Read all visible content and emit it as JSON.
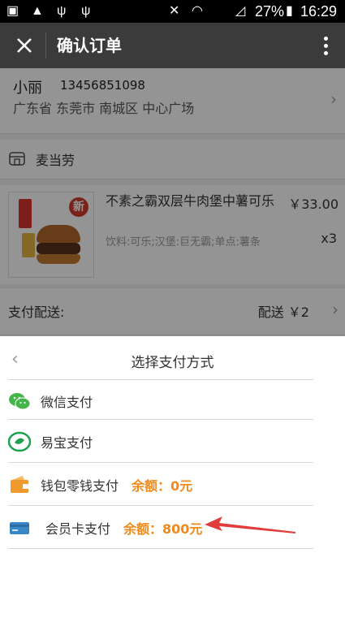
{
  "status_bar": {
    "battery": "27%",
    "time": "16:29"
  },
  "header": {
    "title": "确认订单"
  },
  "address": {
    "name": "小丽",
    "phone": "13456851098",
    "detail": "广东省 东莞市 南城区 中心广场"
  },
  "shop": {
    "name": "麦当劳"
  },
  "item": {
    "badge": "新",
    "name": "不素之霸双层牛肉堡中薯可乐",
    "desc": "饮料:可乐;汉堡:巨无霸;单点:薯条",
    "price": "￥33.00",
    "qty": "x3"
  },
  "delivery": {
    "label": "支付配送:",
    "value": "配送 ￥2"
  },
  "payment_sheet": {
    "title": "选择支付方式",
    "options": [
      {
        "label": "微信支付",
        "balance": ""
      },
      {
        "label": "易宝支付",
        "balance": ""
      },
      {
        "label": "钱包零钱支付",
        "balance": "余额：0元"
      },
      {
        "label": "会员卡支付",
        "balance": "余额：800元"
      }
    ]
  },
  "colors": {
    "balance": "#f08a1a",
    "wechat": "#44b549",
    "yibao": "#1ea04f",
    "wallet": "#f09a2e",
    "card": "#3b86c5",
    "arrow": "#e23b3b"
  }
}
